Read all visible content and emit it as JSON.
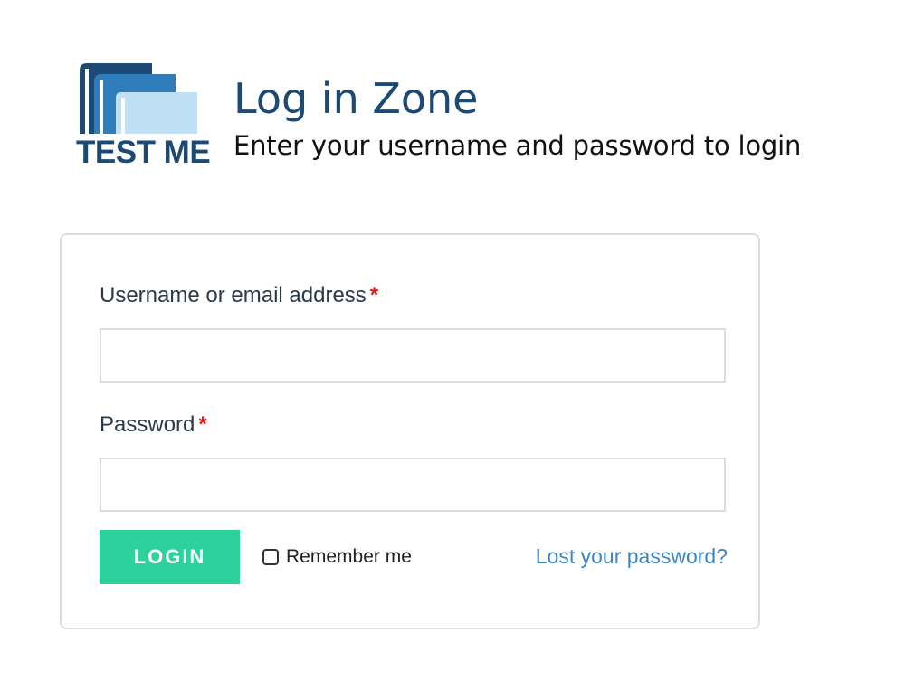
{
  "header": {
    "logo_text": "TEST ME",
    "title": "Log in Zone",
    "subtitle": "Enter your username and password to login"
  },
  "login_form": {
    "username": {
      "label": "Username or email address",
      "required_marker": "*",
      "value": "",
      "placeholder": ""
    },
    "password": {
      "label": "Password",
      "required_marker": "*",
      "value": "",
      "placeholder": ""
    },
    "login_button_label": "LOGIN",
    "remember_me": {
      "label": "Remember me",
      "checked": false
    },
    "lost_password_link": "Lost your password?"
  },
  "colors": {
    "brand_dark": "#1c4a74",
    "brand_mid": "#2f7dbb",
    "brand_light": "#c0e0f6",
    "accent_button": "#2dd19b",
    "link": "#3d86c4",
    "required": "#e21b1b"
  },
  "icons": {
    "logo": "books-logo-icon",
    "remember_checkbox": "checkbox-unchecked"
  }
}
